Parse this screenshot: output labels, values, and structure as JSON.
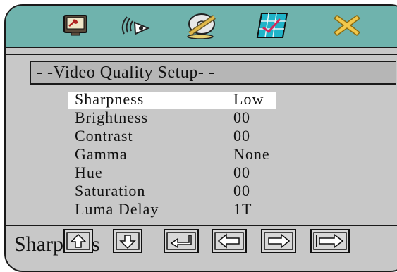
{
  "top_icons": [
    {
      "name": "general-setup-icon"
    },
    {
      "name": "audio-setup-icon"
    },
    {
      "name": "dolby-digital-setup-icon"
    },
    {
      "name": "video-setup-icon"
    },
    {
      "name": "exit-icon"
    }
  ],
  "section": {
    "title": "- -Video Quality Setup- -"
  },
  "menu": [
    {
      "label": "Sharpness",
      "value": "Low",
      "selected": true
    },
    {
      "label": "Brightness",
      "value": "00"
    },
    {
      "label": "Contrast",
      "value": "00"
    },
    {
      "label": "Gamma",
      "value": "None"
    },
    {
      "label": "Hue",
      "value": "00"
    },
    {
      "label": "Saturation",
      "value": "00"
    },
    {
      "label": "Luma Delay",
      "value": "1T"
    }
  ],
  "status": {
    "text": "Sharpness"
  },
  "nav_buttons": [
    {
      "name": "up-arrow-icon"
    },
    {
      "name": "down-arrow-icon"
    },
    {
      "name": "enter-icon"
    },
    {
      "name": "left-arrow-icon"
    },
    {
      "name": "right-arrow-icon"
    },
    {
      "name": "next-page-icon"
    }
  ],
  "colors": {
    "osd_background": "#c8c8c8",
    "top_bar": "#6fb3ad",
    "section_bar": "#b6b6b6",
    "selection_highlight": "#ffffff",
    "exit_icon": "#f2c84b",
    "video_icon": "#1fb3c8"
  }
}
